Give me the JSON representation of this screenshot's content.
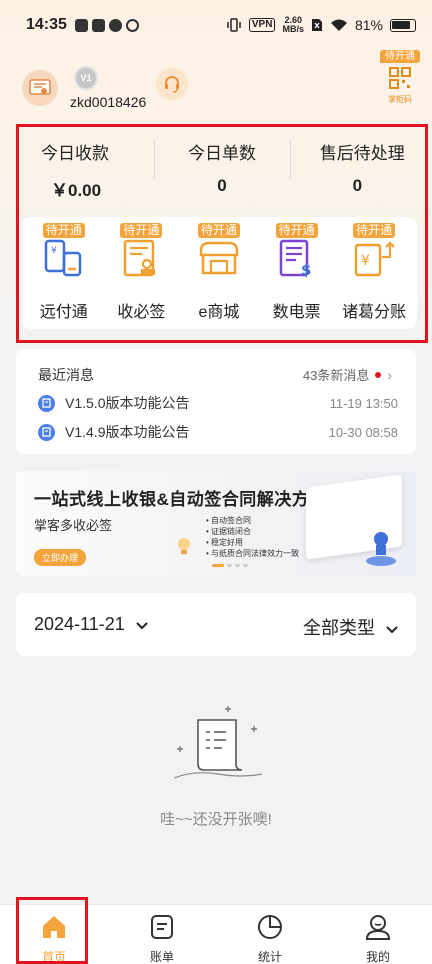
{
  "status_bar": {
    "time": "14:35",
    "vpn": "VPN",
    "speed_value": "2.60",
    "speed_unit": "MB/s",
    "battery": "81%"
  },
  "header": {
    "username": "zkd0018426",
    "avatar_text": "V1",
    "qr_badge": "待开通",
    "qr_label": "掌柜码"
  },
  "stats": [
    {
      "label": "今日收款",
      "value": "￥0.00"
    },
    {
      "label": "今日单数",
      "value": "0"
    },
    {
      "label": "售后待处理",
      "value": "0"
    }
  ],
  "services": [
    {
      "badge": "待开通",
      "label": "远付通",
      "color": "#3f6fd8"
    },
    {
      "badge": "待开通",
      "label": "收必签",
      "color": "#f0a02e"
    },
    {
      "badge": "待开通",
      "label": "e商城",
      "color": "#f0a02e"
    },
    {
      "badge": "待开通",
      "label": "数电票",
      "color": "#7b45d2"
    },
    {
      "badge": "待开通",
      "label": "诸葛分账",
      "color": "#f0a02e"
    }
  ],
  "messages": {
    "title": "最近消息",
    "count_label": "43条新消息",
    "items": [
      {
        "title": "V1.5.0版本功能公告",
        "time": "11-19 13:50"
      },
      {
        "title": "V1.4.9版本功能公告",
        "time": "10-30 08:58"
      }
    ]
  },
  "banner": {
    "title": "一站式线上收银&自动签合同解决方案",
    "subtitle": "掌客多收必签",
    "button": "立即办理",
    "features": [
      "自动签合同",
      "证据链闭合",
      "稳定好用",
      "与纸质合同法律效力一致"
    ]
  },
  "filter": {
    "date": "2024-11-21",
    "type": "全部类型"
  },
  "empty": {
    "text": "哇~~还没开张噢!"
  },
  "tabs": [
    {
      "label": "首页",
      "icon": "home-icon"
    },
    {
      "label": "账单",
      "icon": "bill-icon"
    },
    {
      "label": "统计",
      "icon": "stats-icon"
    },
    {
      "label": "我的",
      "icon": "profile-icon"
    }
  ],
  "colors": {
    "accent": "#f4a43d",
    "highlight_box": "#e0141e"
  }
}
